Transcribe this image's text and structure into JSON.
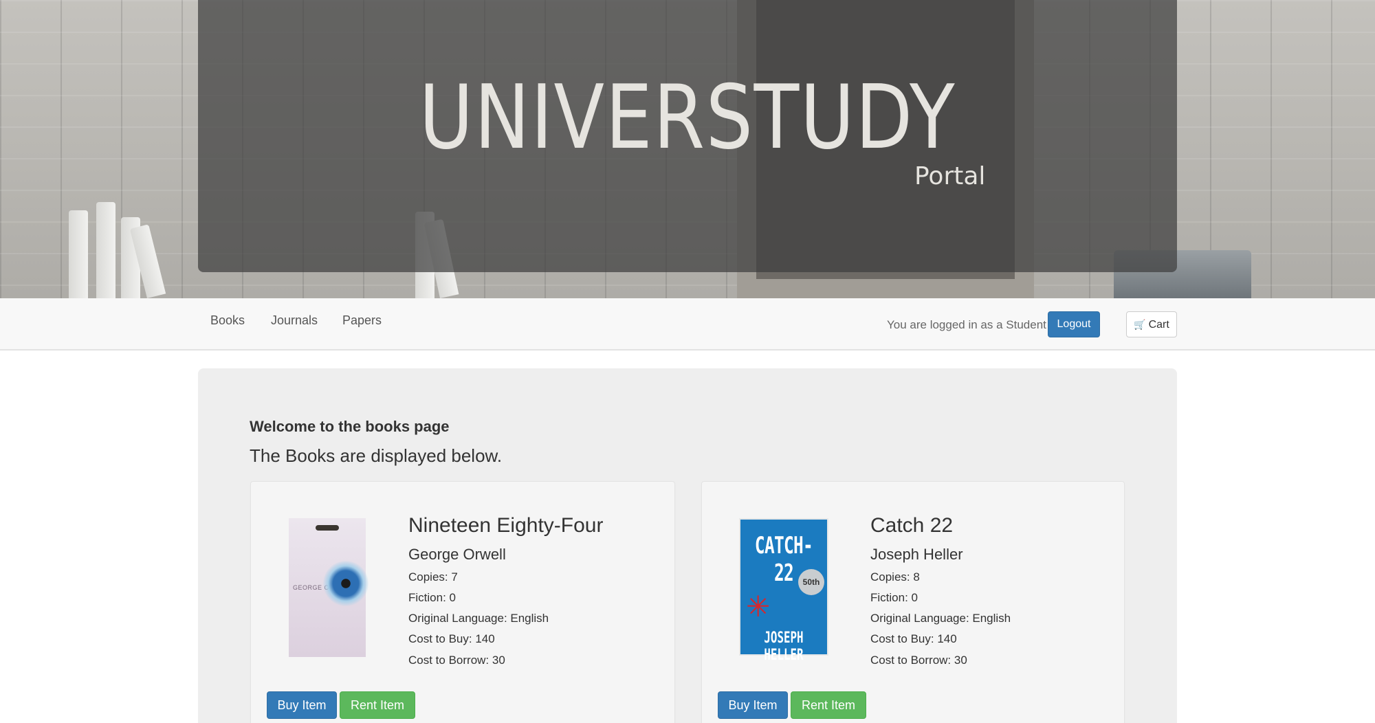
{
  "hero": {
    "title": "UNIVERSTUDY",
    "subtitle": "Portal"
  },
  "navbar": {
    "links": [
      "Books",
      "Journals",
      "Papers"
    ],
    "status_text": "You are logged in as a Student",
    "logout_label": "Logout",
    "cart_label": "Cart",
    "cart_icon": "shopping-cart-icon"
  },
  "main": {
    "welcome": "Welcome to the books page",
    "lead": "The Books are displayed below."
  },
  "books": [
    {
      "title": "Nineteen Eighty-Four",
      "author": "George Orwell",
      "copies": "Copies: 7",
      "fiction": "Fiction: 0",
      "language": "Original Language: English",
      "cost_buy": "Cost to Buy: 140",
      "cost_borrow": "Cost to Borrow: 30",
      "cover_text": "GEORGE ORWELL",
      "buy_label": "Buy Item",
      "rent_label": "Rent Item"
    },
    {
      "title": "Catch 22",
      "author": "Joseph Heller",
      "copies": "Copies: 8",
      "fiction": "Fiction: 0",
      "language": "Original Language: English",
      "cost_buy": "Cost to Buy: 140",
      "cost_borrow": "Cost to Borrow: 30",
      "cover_title": "CATCH-22",
      "cover_badge": "50th",
      "cover_author": "JOSEPH HELLER",
      "buy_label": "Buy Item",
      "rent_label": "Rent Item"
    }
  ]
}
